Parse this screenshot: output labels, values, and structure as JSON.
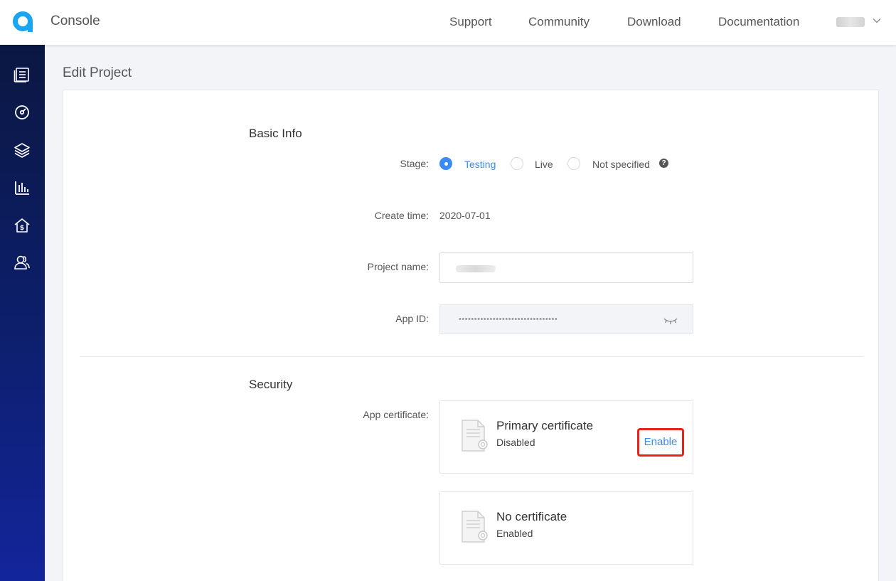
{
  "header": {
    "app_title": "Console",
    "nav": [
      "Support",
      "Community",
      "Download",
      "Documentation"
    ],
    "user_menu_icon": "chevron-down-icon"
  },
  "sidebar": {
    "items": [
      {
        "icon": "projects-icon"
      },
      {
        "icon": "dashboard-gauge-icon"
      },
      {
        "icon": "layers-icon"
      },
      {
        "icon": "analytics-bar-icon"
      },
      {
        "icon": "billing-house-icon"
      },
      {
        "icon": "members-icon"
      }
    ]
  },
  "page": {
    "title": "Edit Project"
  },
  "basic_info": {
    "title": "Basic Info",
    "stage_label": "Stage:",
    "stage_options": [
      "Testing",
      "Live",
      "Not specified"
    ],
    "stage_selected": "Testing",
    "help_glyph": "?",
    "create_time_label": "Create time:",
    "create_time_value": "2020-07-01",
    "project_name_label": "Project name:",
    "app_id_label": "App ID:",
    "app_id_masked": "••••••••••••••••••••••••••••••••"
  },
  "security": {
    "title": "Security",
    "app_certificate_label": "App certificate:",
    "certificates": [
      {
        "title": "Primary certificate",
        "status": "Disabled",
        "action": "Enable"
      },
      {
        "title": "No certificate",
        "status": "Enabled"
      }
    ]
  },
  "colors": {
    "accent": "#3b8bf5",
    "highlight": "#e8231c",
    "sidebar_top": "#0b1742",
    "sidebar_bottom": "#13259b"
  }
}
